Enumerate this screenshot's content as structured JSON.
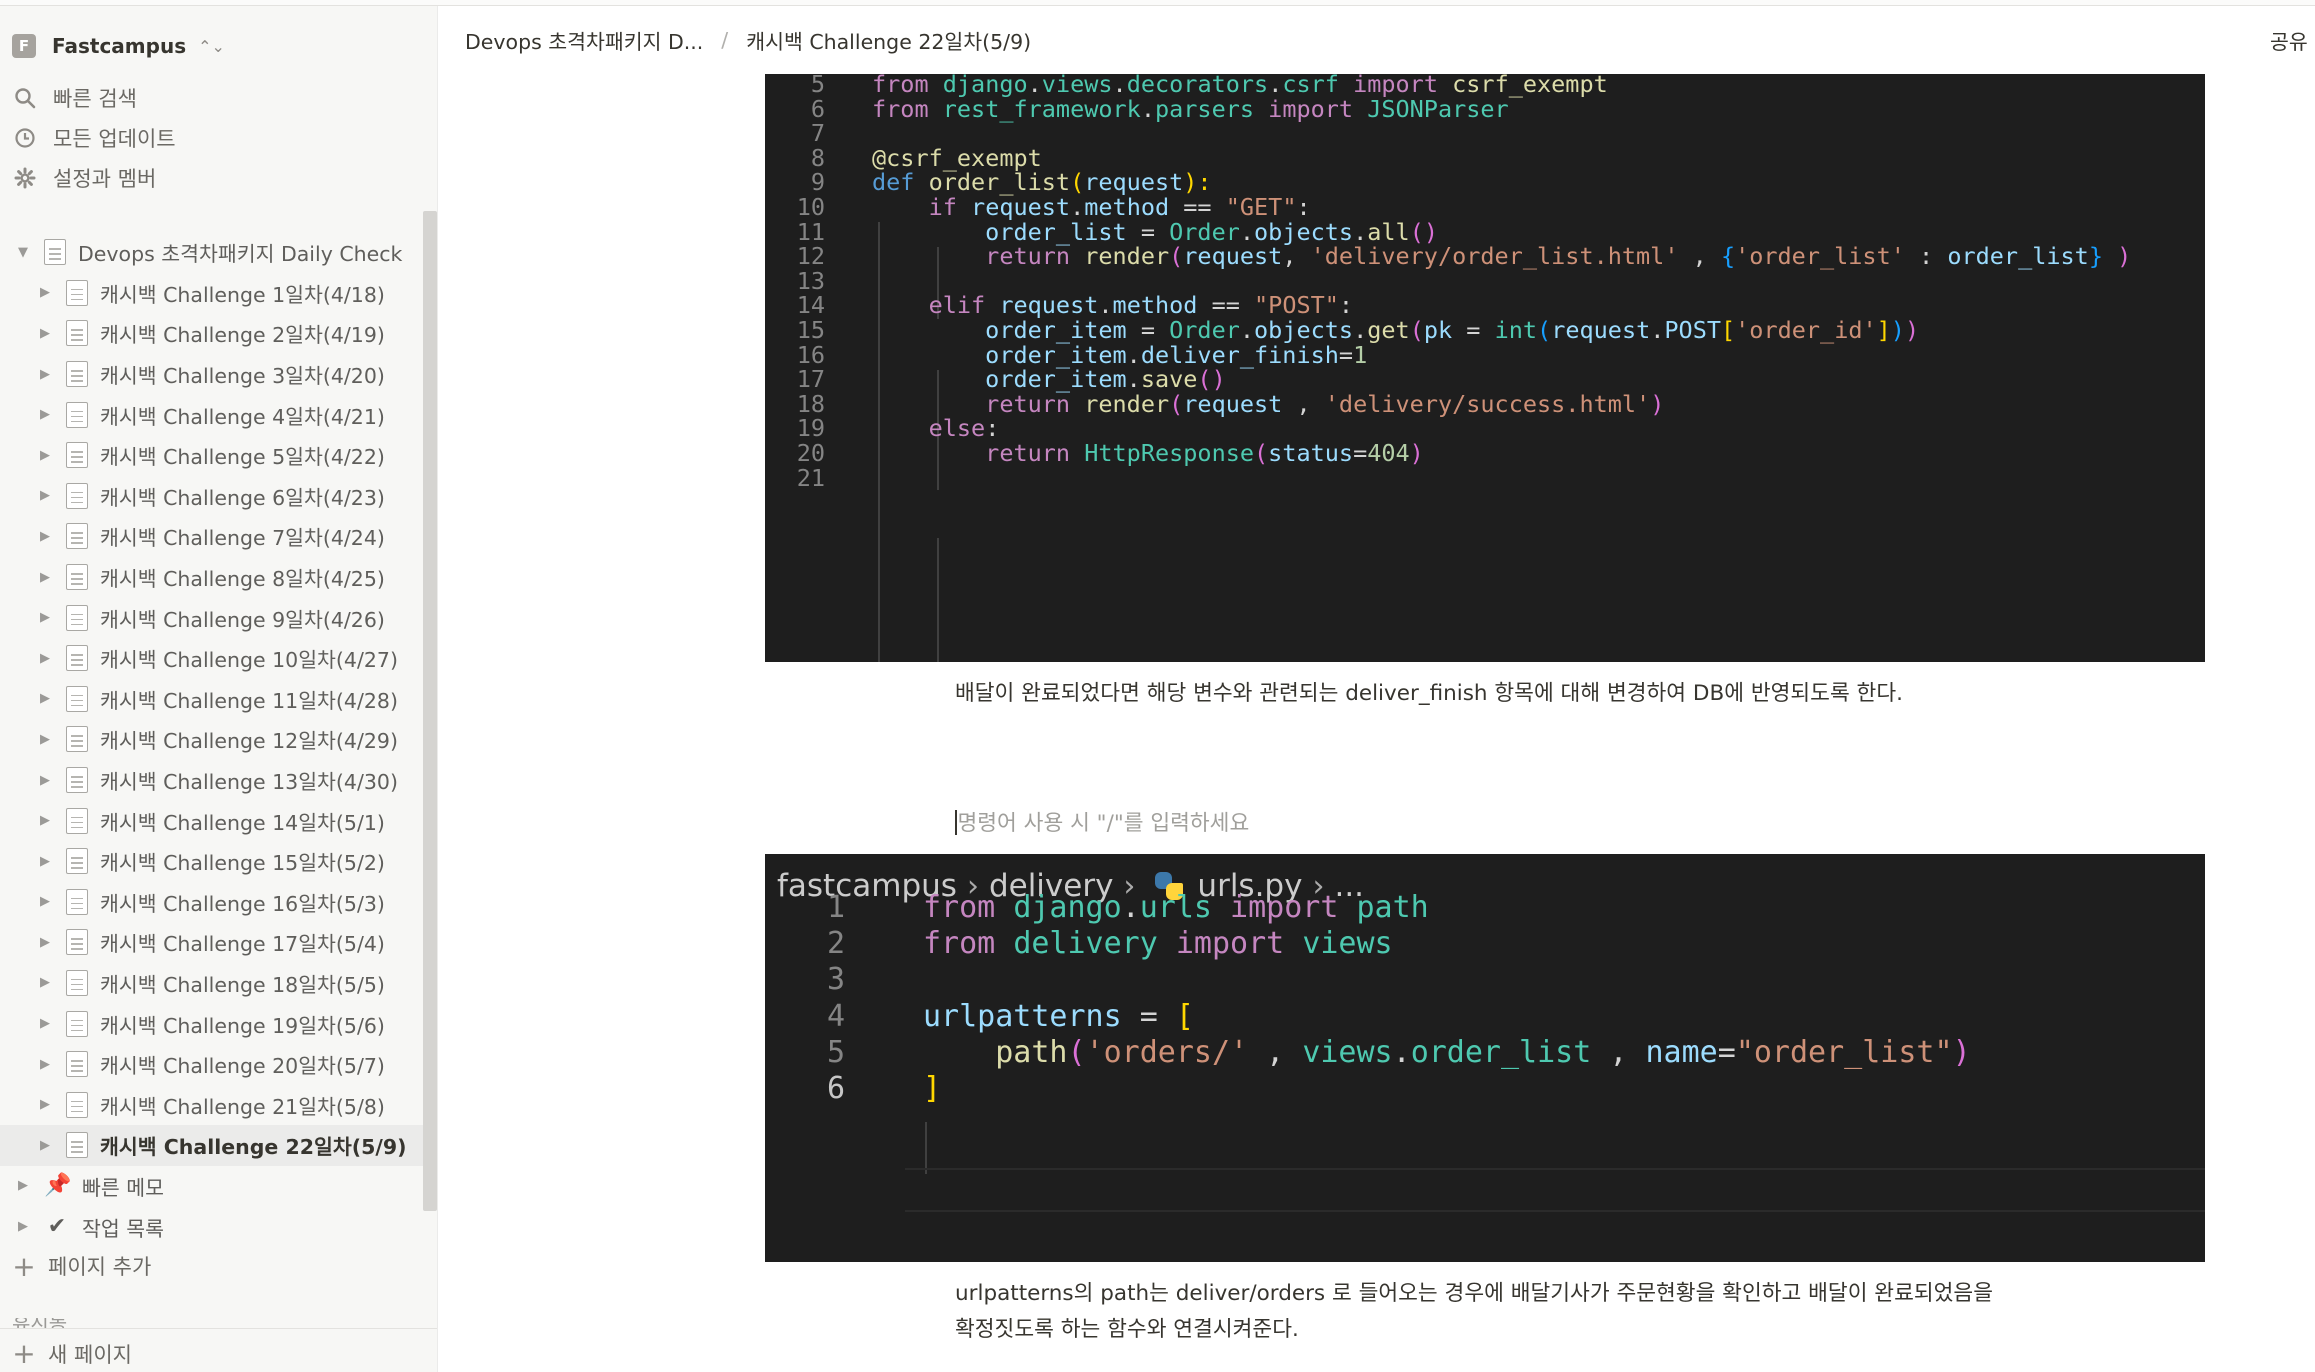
{
  "workspace": {
    "badge": "F",
    "name": "Fastcampus",
    "switch_glyph": "⌃⌄"
  },
  "nav": [
    {
      "icon": "search-icon",
      "label": "빠른 검색"
    },
    {
      "icon": "clock-icon",
      "label": "모든 업데이트"
    },
    {
      "icon": "gear-icon",
      "label": "설정과 멤버"
    }
  ],
  "tree": {
    "root": "Devops 초격차패키지 Daily Check",
    "children": [
      "캐시백 Challenge 1일차(4/18)",
      "캐시백 Challenge 2일차(4/19)",
      "캐시백 Challenge 3일차(4/20)",
      "캐시백 Challenge 4일차(4/21)",
      "캐시백 Challenge 5일차(4/22)",
      "캐시백 Challenge 6일차(4/23)",
      "캐시백 Challenge 7일차(4/24)",
      "캐시백 Challenge 8일차(4/25)",
      "캐시백 Challenge 9일차(4/26)",
      "캐시백 Challenge 10일차(4/27)",
      "캐시백 Challenge 11일차(4/28)",
      "캐시백 Challenge 12일차(4/29)",
      "캐시백 Challenge 13일차(4/30)",
      "캐시백 Challenge 14일차(5/1)",
      "캐시백 Challenge 15일차(5/2)",
      "캐시백 Challenge 16일차(5/3)",
      "캐시백 Challenge 17일차(5/4)",
      "캐시백 Challenge 18일차(5/5)",
      "캐시백 Challenge 19일차(5/6)",
      "캐시백 Challenge 20일차(5/7)",
      "캐시백 Challenge 21일차(5/8)",
      "캐시백 Challenge 22일차(5/9)"
    ],
    "selected_index": 21,
    "others": [
      {
        "emoji": "📌",
        "label": "빠른 메모"
      },
      {
        "emoji": "✔",
        "label": "작업 목록"
      }
    ]
  },
  "sidebar_footer": {
    "add_page": "페이지 추가",
    "trash": "휴지통",
    "new_page": "새 페이지"
  },
  "header": {
    "breadcrumb_parent": "Devops 초격차패키지 D...",
    "breadcrumb_sep": "/",
    "breadcrumb_current": "캐시백 Challenge 22일차(5/9)",
    "share": "공유"
  },
  "content": {
    "paragraph1": "배달이 완료되었다면  해당 변수와 관련되는 deliver_finish 항목에 대해 변경하여 DB에 반영되도록 한다.",
    "placeholder": "명령어 사용 시 \"/\"를 입력하세요",
    "paragraph2": "urlpatterns의 path는 deliver/orders 로 들어오는 경우에 배달기사가 주문현황을 확인하고 배달이 완료되었음을 확정짓도록 하는 함수와 연결시켜준다."
  },
  "code1": [
    {
      "n": "5",
      "t": [
        [
          "from ",
          "kw"
        ],
        [
          "django",
          "c"
        ],
        [
          ".",
          "p"
        ],
        [
          "views",
          "c"
        ],
        [
          ".",
          "p"
        ],
        [
          "decorators",
          "c"
        ],
        [
          ".",
          "p"
        ],
        [
          "csrf",
          "c"
        ],
        [
          " import ",
          "kw"
        ],
        [
          "csrf_exempt",
          "f"
        ]
      ]
    },
    {
      "n": "6",
      "t": [
        [
          "from ",
          "kw"
        ],
        [
          "rest_framework",
          "c"
        ],
        [
          ".",
          "p"
        ],
        [
          "parsers",
          "c"
        ],
        [
          " import ",
          "kw"
        ],
        [
          "JSONParser",
          "c"
        ]
      ]
    },
    {
      "n": "7",
      "t": []
    },
    {
      "n": "8",
      "t": [
        [
          "@csrf_exempt",
          "f"
        ]
      ]
    },
    {
      "n": "9",
      "t": [
        [
          "def ",
          "k"
        ],
        [
          "order_list",
          "f"
        ],
        [
          "(",
          "y"
        ],
        [
          "request",
          "v"
        ],
        [
          "):",
          "y"
        ]
      ]
    },
    {
      "n": "10",
      "t": [
        [
          "    if ",
          "kw"
        ],
        [
          "request",
          "v"
        ],
        [
          ".",
          "p"
        ],
        [
          "method",
          "v"
        ],
        [
          " == ",
          "p"
        ],
        [
          "\"GET\"",
          "s"
        ],
        [
          ":",
          "p"
        ]
      ]
    },
    {
      "n": "11",
      "t": [
        [
          "        order_list",
          "v"
        ],
        [
          " = ",
          "p"
        ],
        [
          "Order",
          "c"
        ],
        [
          ".",
          "p"
        ],
        [
          "objects",
          "v"
        ],
        [
          ".",
          "p"
        ],
        [
          "all",
          "f"
        ],
        [
          "()",
          "pu"
        ]
      ]
    },
    {
      "n": "12",
      "t": [
        [
          "        return ",
          "kw"
        ],
        [
          "render",
          "f"
        ],
        [
          "(",
          "pu"
        ],
        [
          "request",
          "v"
        ],
        [
          ", ",
          "p"
        ],
        [
          "'delivery/order_list.html'",
          "s"
        ],
        [
          " , ",
          "p"
        ],
        [
          "{",
          "bl"
        ],
        [
          "'order_list'",
          "s"
        ],
        [
          " : ",
          "p"
        ],
        [
          "order_list",
          "v"
        ],
        [
          "}",
          "bl"
        ],
        [
          " )",
          "pu"
        ]
      ]
    },
    {
      "n": "13",
      "t": []
    },
    {
      "n": "14",
      "t": [
        [
          "    elif ",
          "kw"
        ],
        [
          "request",
          "v"
        ],
        [
          ".",
          "p"
        ],
        [
          "method",
          "v"
        ],
        [
          " == ",
          "p"
        ],
        [
          "\"POST\"",
          "s"
        ],
        [
          ":",
          "p"
        ]
      ]
    },
    {
      "n": "15",
      "t": [
        [
          "        order_item",
          "v"
        ],
        [
          " = ",
          "p"
        ],
        [
          "Order",
          "c"
        ],
        [
          ".",
          "p"
        ],
        [
          "objects",
          "v"
        ],
        [
          ".",
          "p"
        ],
        [
          "get",
          "f"
        ],
        [
          "(",
          "pu"
        ],
        [
          "pk",
          "v"
        ],
        [
          " = ",
          "p"
        ],
        [
          "int",
          "c"
        ],
        [
          "(",
          "bl"
        ],
        [
          "request",
          "v"
        ],
        [
          ".",
          "p"
        ],
        [
          "POST",
          "v"
        ],
        [
          "[",
          "y"
        ],
        [
          "'order_id'",
          "s"
        ],
        [
          "]",
          "y"
        ],
        [
          ")",
          "bl"
        ],
        [
          ")",
          "pu"
        ]
      ]
    },
    {
      "n": "16",
      "t": [
        [
          "        order_item",
          "v"
        ],
        [
          ".",
          "p"
        ],
        [
          "deliver_finish",
          "v"
        ],
        [
          "=",
          "p"
        ],
        [
          "1",
          "n"
        ]
      ]
    },
    {
      "n": "17",
      "t": [
        [
          "        order_item",
          "v"
        ],
        [
          ".",
          "p"
        ],
        [
          "save",
          "f"
        ],
        [
          "()",
          "pu"
        ]
      ]
    },
    {
      "n": "18",
      "t": [
        [
          "        return ",
          "kw"
        ],
        [
          "render",
          "f"
        ],
        [
          "(",
          "pu"
        ],
        [
          "request",
          "v"
        ],
        [
          " , ",
          "p"
        ],
        [
          "'delivery/success.html'",
          "s"
        ],
        [
          ")",
          "pu"
        ]
      ]
    },
    {
      "n": "19",
      "t": [
        [
          "    else",
          "kw"
        ],
        [
          ":",
          "p"
        ]
      ]
    },
    {
      "n": "20",
      "t": [
        [
          "        return ",
          "kw"
        ],
        [
          "HttpResponse",
          "c"
        ],
        [
          "(",
          "pu"
        ],
        [
          "status",
          "v"
        ],
        [
          "=",
          "p"
        ],
        [
          "404",
          "n"
        ],
        [
          ")",
          "pu"
        ]
      ]
    },
    {
      "n": "21",
      "t": []
    }
  ],
  "code2_breadcrumb": {
    "folder1": "fastcampus",
    "folder2": "delivery",
    "file": "urls.py",
    "more": "..."
  },
  "code2": [
    {
      "n": "1",
      "t": [
        [
          "from ",
          "kw"
        ],
        [
          "django",
          "c"
        ],
        [
          ".",
          "p"
        ],
        [
          "urls",
          "c"
        ],
        [
          " import ",
          "kw"
        ],
        [
          "path",
          "c"
        ]
      ]
    },
    {
      "n": "2",
      "t": [
        [
          "from ",
          "kw"
        ],
        [
          "delivery",
          "c"
        ],
        [
          " import ",
          "kw"
        ],
        [
          "views",
          "c"
        ]
      ]
    },
    {
      "n": "3",
      "t": []
    },
    {
      "n": "4",
      "t": [
        [
          "urlpatterns",
          "v"
        ],
        [
          " = ",
          "p"
        ],
        [
          "[",
          "y"
        ]
      ]
    },
    {
      "n": "5",
      "t": [
        [
          "    path",
          "f"
        ],
        [
          "(",
          "pu"
        ],
        [
          "'orders/'",
          "s"
        ],
        [
          " , ",
          "p"
        ],
        [
          "views",
          "c"
        ],
        [
          ".",
          "p"
        ],
        [
          "order_list",
          "c"
        ],
        [
          " , ",
          "p"
        ],
        [
          "name",
          "v"
        ],
        [
          "=",
          "p"
        ],
        [
          "\"order_list\"",
          "s"
        ],
        [
          ")",
          "pu"
        ]
      ]
    },
    {
      "n": "6",
      "t": [
        [
          "]",
          "y"
        ]
      ]
    }
  ]
}
